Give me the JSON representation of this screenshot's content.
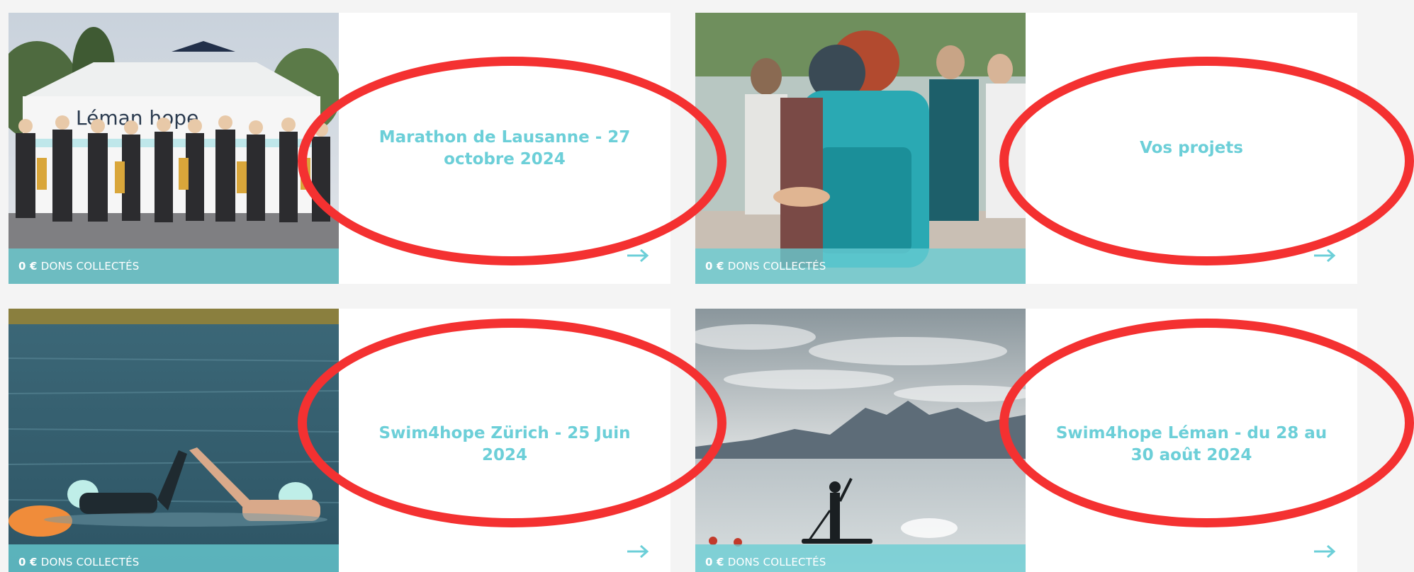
{
  "colors": {
    "accent": "#6ccfd8",
    "band": "#68cdd4",
    "annotation": "#f43131",
    "background": "#f4f4f4"
  },
  "cards": [
    {
      "title": "Marathon de Lausanne - 27 octobre 2024",
      "amount": "0 €",
      "collected_label": "DONS COLLECTÉS",
      "sign_text": "Léman hope",
      "arrow_icon": "arrow-right-icon"
    },
    {
      "title": "Vos projets",
      "amount": "0 €",
      "collected_label": "DONS COLLECTÉS",
      "arrow_icon": "arrow-right-icon"
    },
    {
      "title": "Swim4hope Zürich - 25 Juin 2024",
      "amount": "0 €",
      "collected_label": "DONS COLLECTÉS",
      "arrow_icon": "arrow-right-icon"
    },
    {
      "title": "Swim4hope Léman - du 28 au 30 août 2024",
      "amount": "0 €",
      "collected_label": "DONS COLLECTÉS",
      "arrow_icon": "arrow-right-icon"
    }
  ]
}
